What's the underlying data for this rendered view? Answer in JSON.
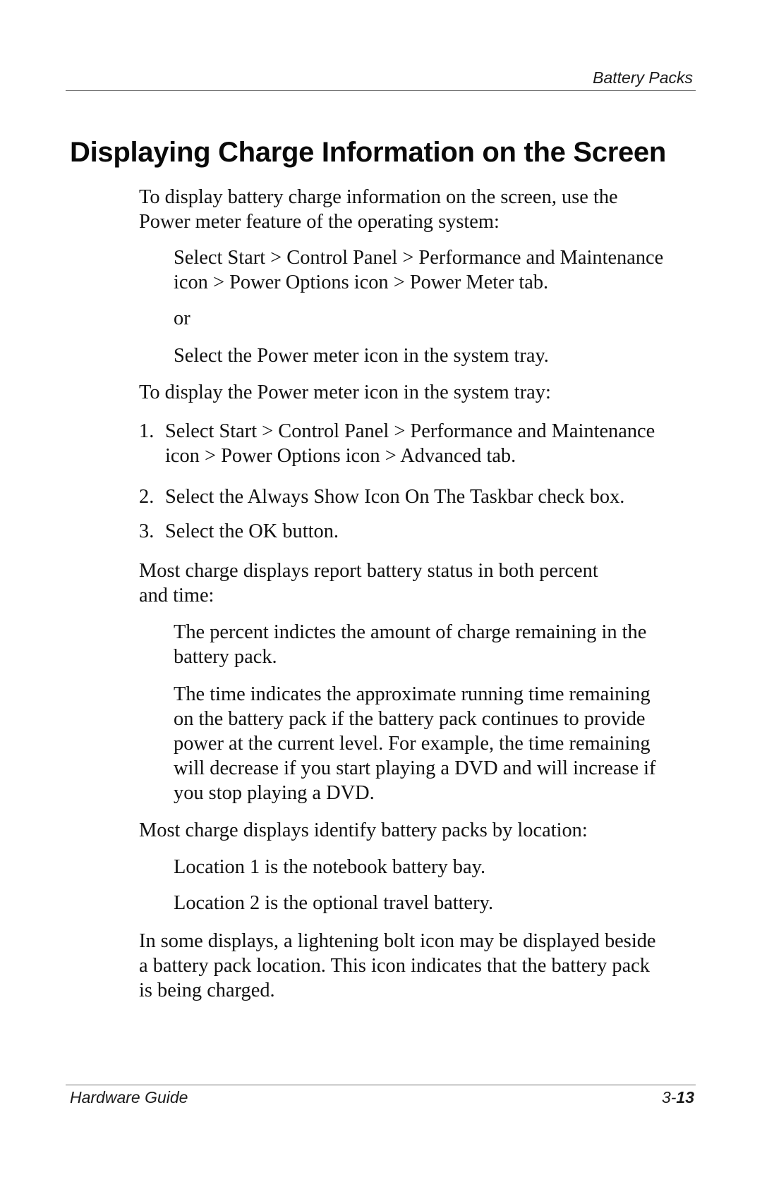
{
  "header": {
    "section_title": "Battery Packs"
  },
  "page": {
    "heading": "Displaying Charge Information on the Screen",
    "intro": {
      "lines": [
        "To display battery charge information on the screen, use the",
        "Power meter feature of the operating system:"
      ]
    },
    "option_a": {
      "lines": [
        "Select Start > Control Panel > Performance and Maintenance",
        "icon > Power Options icon > Power Meter tab."
      ]
    },
    "or_text": "or",
    "option_b": {
      "lines": [
        "Select the Power meter icon in the system tray."
      ]
    },
    "tray_intro": "To display the Power meter icon in the system tray:",
    "steps": [
      {
        "number": "1.",
        "lines": [
          "Select Start > Control Panel > Performance and Maintenance",
          "icon > Power Options icon > Advanced tab."
        ]
      },
      {
        "number": "2.",
        "lines": [
          "Select the Always Show Icon On The Taskbar check box."
        ]
      },
      {
        "number": "3.",
        "lines": [
          "Select the OK button."
        ]
      }
    ],
    "status_intro": {
      "lines": [
        "Most charge displays report battery status in both percent",
        "and time:"
      ]
    },
    "percent_desc": {
      "lines": [
        "The percent indictes the amount of charge remaining in the",
        "battery pack."
      ]
    },
    "time_desc": {
      "lines": [
        "The time indicates the approximate running time remaining",
        "on the battery pack if the battery pack continues to provide",
        "power at the current level. For example, the time remaining",
        "will decrease if you start playing a DVD and will increase if",
        "you stop playing a DVD."
      ]
    },
    "location_intro": "Most charge displays identify battery packs by location:",
    "location_1": "Location 1 is the notebook battery bay.",
    "location_2": "Location 2 is the optional travel battery.",
    "charging_note": {
      "lines": [
        "In some displays, a lightening bolt icon may be displayed beside",
        "a battery pack location. This icon indicates that the battery pack",
        "is being charged."
      ]
    }
  },
  "footer": {
    "guide_title": "Hardware Guide",
    "page_chapter": "3-",
    "page_number": "13"
  }
}
